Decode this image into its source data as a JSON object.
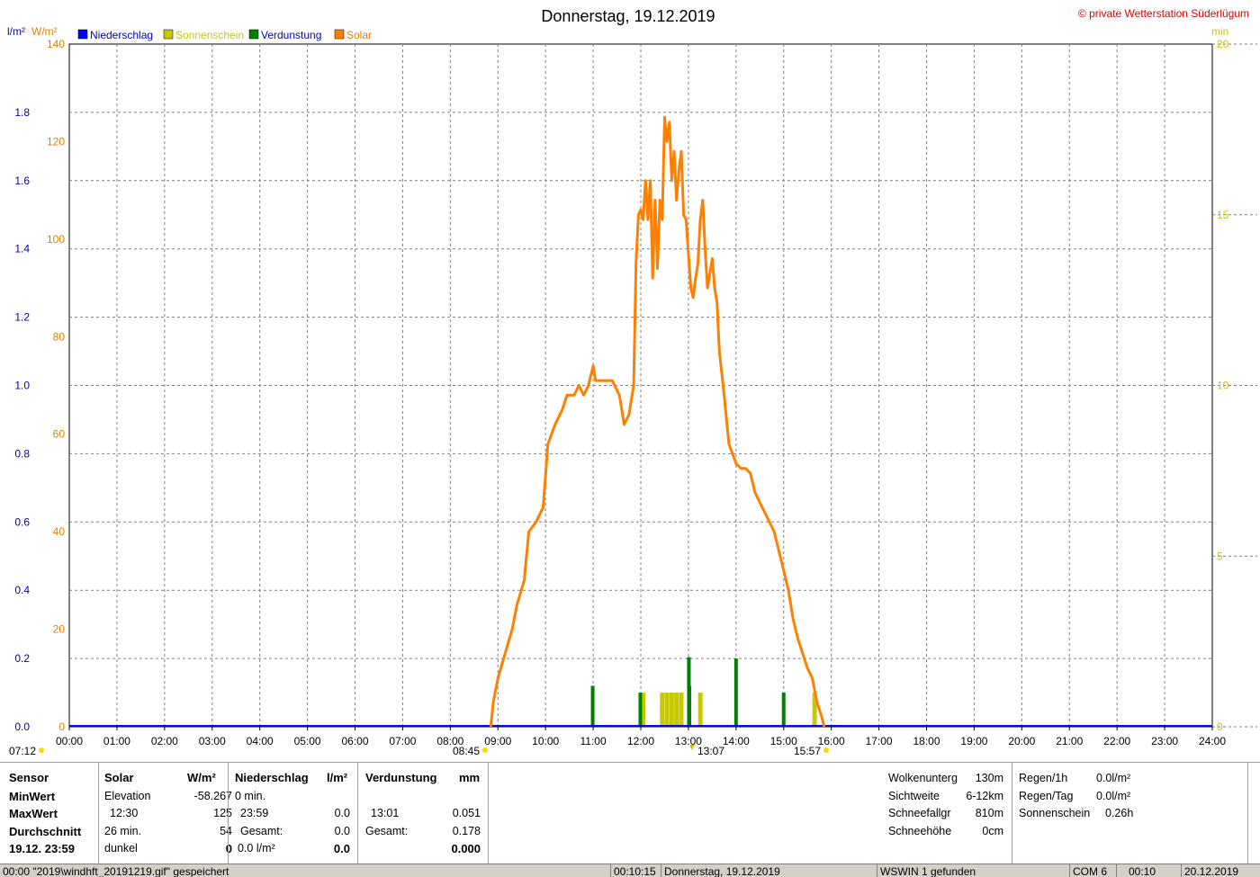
{
  "header": {
    "title": "Donnerstag, 19.12.2019",
    "copyright": "© private Wetterstation Süderlügum"
  },
  "legend": {
    "unit_left1": "l/m²",
    "unit_left2": "W/m²",
    "unit_right": "min",
    "items": [
      {
        "label": "Niederschlag",
        "color": "#0000ff"
      },
      {
        "label": "Sonnenschein",
        "color": "#c8c800"
      },
      {
        "label": "Verdunstung",
        "color": "#008000"
      },
      {
        "label": "Solar",
        "color": "#ff8000"
      }
    ]
  },
  "sun": {
    "rise_top": "07:12",
    "rise_main": "08:45",
    "max_time": "13:07",
    "set_time": "15:57"
  },
  "colors": {
    "solar": "#ff8000",
    "sunshine": "#c8c800",
    "evaporation": "#008000",
    "precip": "#0000ff",
    "axis_blue": "#0000c0",
    "axis_orange": "#e08000",
    "axis_yellow": "#c8c800",
    "grid": "#808080"
  },
  "chart_data": {
    "type": "line",
    "x_unit": "hours",
    "xlim": [
      0,
      24
    ],
    "x_ticks": [
      "00:00",
      "01:00",
      "02:00",
      "03:00",
      "04:00",
      "05:00",
      "06:00",
      "07:00",
      "08:00",
      "09:00",
      "10:00",
      "11:00",
      "12:00",
      "13:00",
      "14:00",
      "15:00",
      "16:00",
      "17:00",
      "18:00",
      "19:00",
      "20:00",
      "21:00",
      "22:00",
      "23:00",
      "24:00"
    ],
    "y_left_precip": {
      "label": "l/m²",
      "ylim": [
        0,
        2.0
      ],
      "ticks": [
        "0.0",
        "0.2",
        "0.4",
        "0.6",
        "0.8",
        "1.0",
        "1.2",
        "1.4",
        "1.6",
        "1.8"
      ]
    },
    "y_left_solar": {
      "label": "W/m²",
      "ylim": [
        0,
        140
      ],
      "ticks": [
        "0",
        "20",
        "40",
        "60",
        "80",
        "100",
        "120",
        "140"
      ]
    },
    "y_right_sunshine": {
      "label": "min",
      "ylim": [
        0,
        20
      ],
      "ticks": [
        "0",
        "5",
        "10",
        "15",
        "20"
      ]
    },
    "grid": true,
    "series": [
      {
        "name": "Solar",
        "axis": "W/m²",
        "points": [
          [
            8.85,
            0
          ],
          [
            8.9,
            5
          ],
          [
            9.0,
            10
          ],
          [
            9.15,
            15
          ],
          [
            9.3,
            20
          ],
          [
            9.4,
            25
          ],
          [
            9.55,
            30
          ],
          [
            9.65,
            40
          ],
          [
            9.8,
            42
          ],
          [
            9.95,
            45
          ],
          [
            10.05,
            58
          ],
          [
            10.2,
            62
          ],
          [
            10.35,
            65
          ],
          [
            10.45,
            68
          ],
          [
            10.6,
            68
          ],
          [
            10.7,
            70
          ],
          [
            10.8,
            68
          ],
          [
            10.9,
            70
          ],
          [
            10.95,
            72
          ],
          [
            11.0,
            74
          ],
          [
            11.05,
            71
          ],
          [
            11.2,
            71
          ],
          [
            11.4,
            71
          ],
          [
            11.55,
            68
          ],
          [
            11.65,
            62
          ],
          [
            11.75,
            64
          ],
          [
            11.85,
            70
          ],
          [
            11.9,
            95
          ],
          [
            11.95,
            105
          ],
          [
            12.0,
            106
          ],
          [
            12.05,
            104
          ],
          [
            12.1,
            112
          ],
          [
            12.15,
            104
          ],
          [
            12.2,
            112
          ],
          [
            12.25,
            92
          ],
          [
            12.3,
            108
          ],
          [
            12.35,
            94
          ],
          [
            12.4,
            108
          ],
          [
            12.45,
            104
          ],
          [
            12.5,
            125
          ],
          [
            12.55,
            120
          ],
          [
            12.6,
            124
          ],
          [
            12.65,
            112
          ],
          [
            12.7,
            118
          ],
          [
            12.75,
            108
          ],
          [
            12.8,
            114
          ],
          [
            12.85,
            118
          ],
          [
            12.9,
            105
          ],
          [
            12.95,
            104
          ],
          [
            13.0,
            97
          ],
          [
            13.05,
            90
          ],
          [
            13.1,
            88
          ],
          [
            13.15,
            92
          ],
          [
            13.2,
            95
          ],
          [
            13.25,
            104
          ],
          [
            13.3,
            108
          ],
          [
            13.35,
            98
          ],
          [
            13.4,
            90
          ],
          [
            13.5,
            96
          ],
          [
            13.55,
            90
          ],
          [
            13.6,
            87
          ],
          [
            13.65,
            77
          ],
          [
            13.75,
            68
          ],
          [
            13.85,
            58
          ],
          [
            14.0,
            54
          ],
          [
            14.1,
            53
          ],
          [
            14.2,
            53
          ],
          [
            14.3,
            52
          ],
          [
            14.4,
            48
          ],
          [
            14.5,
            46
          ],
          [
            14.6,
            44
          ],
          [
            14.7,
            42
          ],
          [
            14.8,
            40
          ],
          [
            14.9,
            36
          ],
          [
            15.0,
            32
          ],
          [
            15.1,
            28
          ],
          [
            15.2,
            22
          ],
          [
            15.3,
            18
          ],
          [
            15.4,
            15
          ],
          [
            15.5,
            12
          ],
          [
            15.6,
            10
          ],
          [
            15.7,
            5
          ],
          [
            15.8,
            2
          ],
          [
            15.85,
            0
          ]
        ]
      },
      {
        "name": "Sonnenschein",
        "axis": "min",
        "bars": [
          [
            12.05,
            1.0
          ],
          [
            12.45,
            1.0
          ],
          [
            12.55,
            1.0
          ],
          [
            12.65,
            1.0
          ],
          [
            12.75,
            1.0
          ],
          [
            12.85,
            1.0
          ],
          [
            13.25,
            1.0
          ],
          [
            15.65,
            1.0
          ]
        ]
      },
      {
        "name": "Verdunstung",
        "axis": "mm",
        "bars": [
          [
            10.99,
            0.03
          ],
          [
            11.99,
            0.025
          ],
          [
            13.01,
            0.051
          ],
          [
            13.02,
            0.03
          ],
          [
            14.0,
            0.05
          ],
          [
            15.0,
            0.025
          ]
        ]
      },
      {
        "name": "Niederschlag",
        "axis": "l/m²",
        "values_constant": 0.0
      }
    ]
  },
  "stats": {
    "sensor": {
      "head": "Sensor",
      "rows": [
        "MinWert",
        "MaxWert",
        "Durchschnitt",
        "19.12. 23:59"
      ]
    },
    "solar": {
      "head": "Solar",
      "unit": "W/m²",
      "rows": [
        [
          "Elevation",
          "-58.267"
        ],
        [
          "12:30",
          "125"
        ],
        [
          "26 min.",
          "54"
        ],
        [
          "dunkel",
          "0"
        ]
      ]
    },
    "niederschlag": {
      "head": "Niederschlag",
      "unit": "l/m²",
      "rows": [
        [
          "0 min.",
          ""
        ],
        [
          "23:59",
          "0.0"
        ],
        [
          "Gesamt:",
          "0.0"
        ],
        [
          "0.0 l/m²",
          "0.0"
        ]
      ]
    },
    "verdunstung": {
      "head": "Verdunstung",
      "unit": "mm",
      "rows": [
        [
          "",
          ""
        ],
        [
          "13:01",
          "0.051"
        ],
        [
          "Gesamt:",
          "0.178"
        ],
        [
          "",
          "0.000"
        ]
      ]
    },
    "weather1": [
      [
        "Wolkenunterg",
        "130m"
      ],
      [
        "Sichtweite",
        "6-12km"
      ],
      [
        "Schneefallgr",
        "810m"
      ],
      [
        "Schneehöhe",
        "0cm"
      ]
    ],
    "weather2": [
      [
        "Regen/1h",
        "0.0l/m²"
      ],
      [
        "Regen/Tag",
        "0.0l/m²"
      ],
      [
        "Sonnenschein",
        "0.26h"
      ]
    ]
  },
  "status": {
    "msg": "00:00 \"2019\\windhft_20191219.gif\" gespeichert",
    "time1": "00:10:15",
    "date_label": "Donnerstag, 19.12.2019",
    "wswin": "WSWIN 1 gefunden",
    "com": "COM 6",
    "time2": "00:10",
    "date2": "20.12.2019"
  }
}
